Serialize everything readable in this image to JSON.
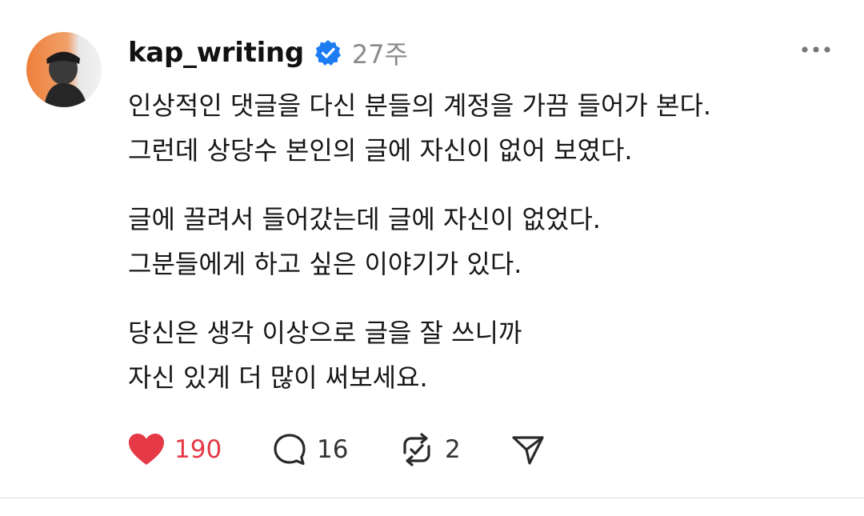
{
  "post": {
    "username": "kap_writing",
    "timestamp": "27주",
    "verified": true,
    "body": {
      "p1": {
        "line1": "인상적인 댓글을 다신 분들의 계정을 가끔 들어가 본다.",
        "line2": "그런데 상당수 본인의 글에 자신이 없어 보였다."
      },
      "p2": {
        "line1": "글에 끌려서 들어갔는데 글에 자신이 없었다.",
        "line2": "그분들에게 하고 싶은 이야기가 있다."
      },
      "p3": {
        "line1": "당신은 생각 이상으로 글을 잘 쓰니까",
        "line2": "자신 있게 더 많이 써보세요."
      }
    },
    "actions": {
      "likes": "190",
      "comments": "16",
      "reposts": "2"
    },
    "colors": {
      "like": "#e53946",
      "verified": "#1d7cf2",
      "timestamp": "#8a8a8a"
    },
    "icons": {
      "verified": "verified-badge-icon",
      "more": "more-dots-icon",
      "like": "heart-icon",
      "comment": "comment-bubble-icon",
      "repost": "repost-icon",
      "share": "send-icon"
    }
  }
}
